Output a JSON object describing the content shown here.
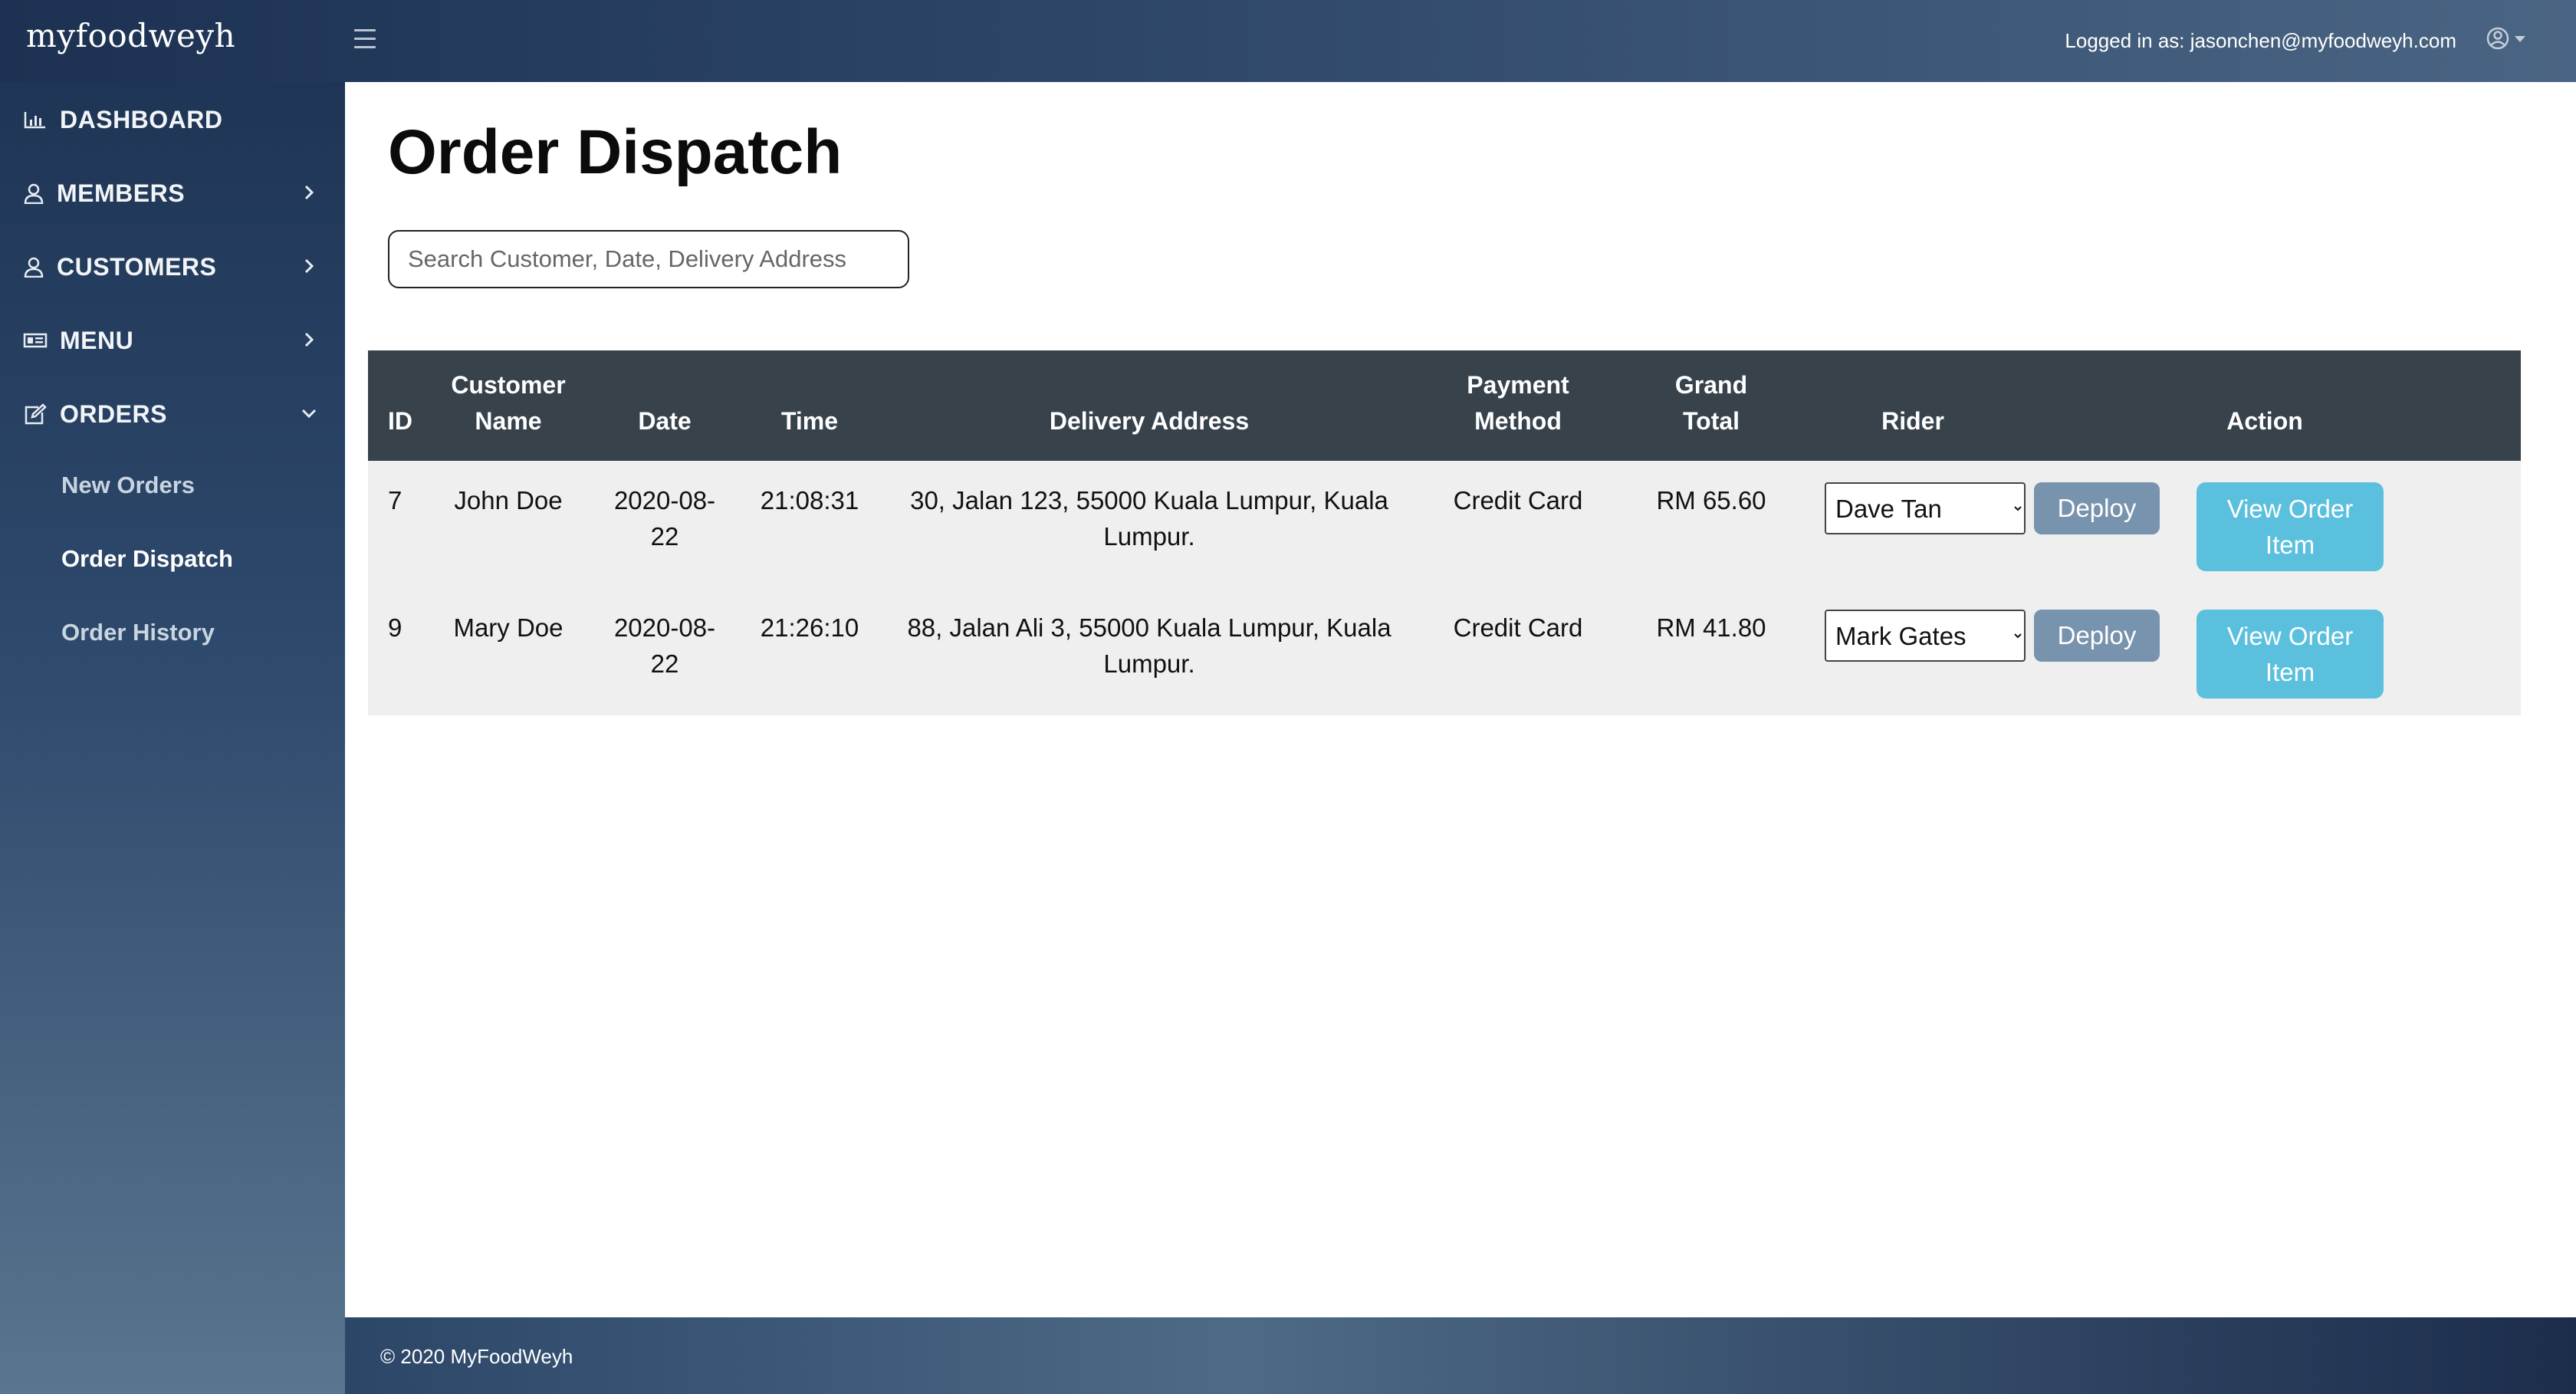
{
  "app": {
    "logo": "myfoodweyh",
    "logged_in_text": "Logged in as: jasonchen@myfoodweyh.com"
  },
  "sidebar": {
    "items": [
      {
        "label": "DASHBOARD",
        "icon": "chart-icon"
      },
      {
        "label": "MEMBERS",
        "icon": "user-icon"
      },
      {
        "label": "CUSTOMERS",
        "icon": "user-icon"
      },
      {
        "label": "MENU",
        "icon": "menu-card-icon"
      },
      {
        "label": "ORDERS",
        "icon": "edit-icon"
      }
    ],
    "orders_sub": [
      {
        "label": "New Orders"
      },
      {
        "label": "Order Dispatch"
      },
      {
        "label": "Order History"
      }
    ]
  },
  "main": {
    "title": "Order Dispatch",
    "search_placeholder": "Search Customer, Date, Delivery Address"
  },
  "table": {
    "headers": {
      "id": "ID",
      "customer_line1": "Customer",
      "customer_line2": "Name",
      "date": "Date",
      "time": "Time",
      "address": "Delivery Address",
      "payment_line1": "Payment",
      "payment_line2": "Method",
      "total_line1": "Grand",
      "total_line2": "Total",
      "rider": "Rider",
      "action": "Action"
    },
    "rows": [
      {
        "id": "7",
        "customer": "John Doe",
        "date": "2020-08-22",
        "time": "21:08:31",
        "address": "30, Jalan 123, 55000 Kuala Lumpur, Kuala Lumpur.",
        "payment": "Credit Card",
        "total": "RM 65.60",
        "rider": "Dave Tan",
        "deploy_label": "Deploy",
        "view_label": "View Order Item"
      },
      {
        "id": "9",
        "customer": "Mary Doe",
        "date": "2020-08-22",
        "time": "21:26:10",
        "address": "88, Jalan Ali 3, 55000 Kuala Lumpur, Kuala Lumpur.",
        "payment": "Credit Card",
        "total": "RM 41.80",
        "rider": "Mark Gates",
        "deploy_label": "Deploy",
        "view_label": "View Order Item"
      }
    ]
  },
  "footer": {
    "text": "© 2020 MyFoodWeyh"
  }
}
